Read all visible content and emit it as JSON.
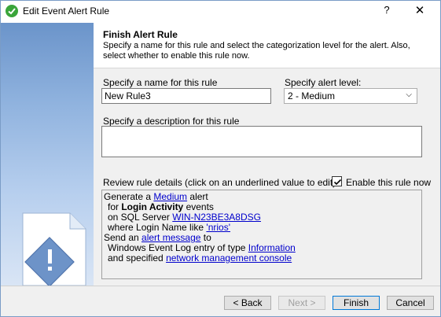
{
  "window": {
    "title": "Edit Event Alert Rule",
    "help_label": "?",
    "close_label": "✕"
  },
  "header": {
    "title": "Finish Alert Rule",
    "description": "Specify a name for this rule and select the categorization level for the alert.  Also, select whether to enable this rule now."
  },
  "form": {
    "name_label": "Specify a name for this rule",
    "name_value": "New Rule3",
    "level_label": "Specify alert level:",
    "level_value": "2 - Medium",
    "description_label": "Specify a description for this rule",
    "review_label": "Review rule details (click on an underlined value to edit)",
    "enable_label": "Enable this rule now",
    "enable_checked": true
  },
  "details": {
    "line1_text": "Generate a ",
    "line1_link": "Medium",
    "line1_tail": " alert",
    "line2_text": "for ",
    "line2_bold": "Login Activity",
    "line2_tail": " events",
    "line3_text": "on SQL Server ",
    "line3_link": "WIN-N23BE3A8DSG",
    "line4_text": "where Login Name like ",
    "line4_link": "'nrios'",
    "line5_text": "Send an ",
    "line5_link": "alert message",
    "line5_tail": " to",
    "line6_text": "Windows Event Log entry of type ",
    "line6_link": "Information",
    "line7_text": "and specified ",
    "line7_link": "network management console"
  },
  "buttons": {
    "back": "< Back",
    "next": "Next >",
    "finish": "Finish",
    "cancel": "Cancel"
  },
  "colors": {
    "link": "#0000cc",
    "accent": "#0078d7",
    "side_gradient_top": "#6b94ca",
    "side_gradient_bottom": "#d9e5f5"
  }
}
